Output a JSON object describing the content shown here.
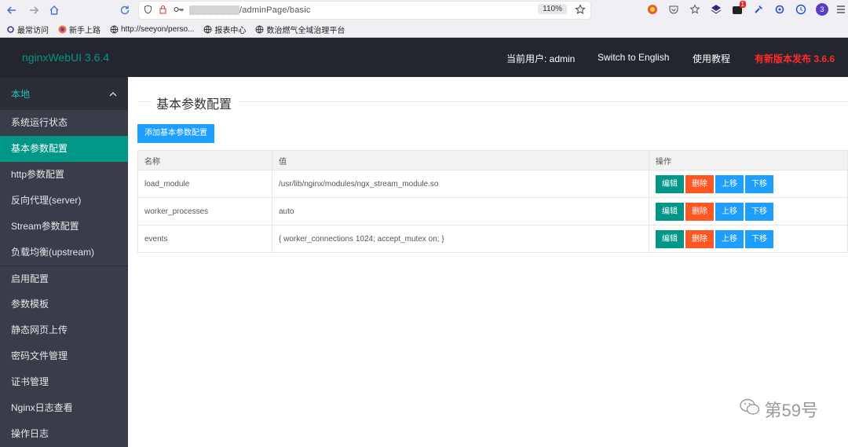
{
  "browser": {
    "url": "▒▒▒▒▒▒▒▒/adminPage/basic",
    "zoom": "110%",
    "bookmarks": [
      {
        "icon": "gear-icon",
        "label": "最常访问"
      },
      {
        "icon": "firefox-icon",
        "label": "新手上路"
      },
      {
        "icon": "globe-icon",
        "label": "http://seeyon/perso..."
      },
      {
        "icon": "globe-icon",
        "label": "报表中心"
      },
      {
        "icon": "globe-icon",
        "label": "数治燃气全域治理平台"
      }
    ],
    "ext_badge": "1",
    "profile_badge": "3"
  },
  "header": {
    "logo": "nginxWebUI 3.6.4",
    "current_user_label": "当前用户: admin",
    "switch_lang": "Switch to English",
    "tutorial": "使用教程",
    "new_version": "有新版本发布 3.6.6"
  },
  "sidebar": {
    "group": "本地",
    "items": [
      {
        "label": "系统运行状态",
        "active": false
      },
      {
        "label": "基本参数配置",
        "active": true
      },
      {
        "label": "http参数配置",
        "active": false
      },
      {
        "label": "反向代理(server)",
        "active": false
      },
      {
        "label": "Stream参数配置",
        "active": false
      },
      {
        "label": "负载均衡(upstream)",
        "active": false
      },
      {
        "label": "启用配置",
        "active": false
      },
      {
        "label": "参数模板",
        "active": false
      },
      {
        "label": "静态网页上传",
        "active": false
      },
      {
        "label": "密码文件管理",
        "active": false
      },
      {
        "label": "证书管理",
        "active": false
      },
      {
        "label": "Nginx日志查看",
        "active": false
      },
      {
        "label": "操作日志",
        "active": false
      }
    ]
  },
  "main": {
    "title": "基本参数配置",
    "add_button": "添加基本参数配置",
    "columns": [
      "名称",
      "值",
      "操作"
    ],
    "rows": [
      {
        "name": "load_module",
        "value": "/usr/lib/nginx/modules/ngx_stream_module.so"
      },
      {
        "name": "worker_processes",
        "value": "auto"
      },
      {
        "name": "events",
        "value": "{ worker_connections 1024; accept_mutex on; }"
      }
    ],
    "actions": {
      "edit": "编辑",
      "delete": "删除",
      "up": "上移",
      "down": "下移"
    }
  },
  "watermark": "第59号",
  "colors": {
    "accent": "#009688",
    "blue": "#1e9fff",
    "danger": "#ff5722",
    "header_bg": "#23262e",
    "sidebar_bg": "#393d49",
    "new_version": "#ff2a2a"
  }
}
